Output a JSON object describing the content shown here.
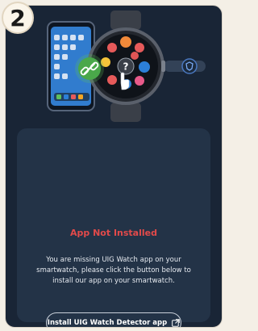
{
  "step": {
    "number": "2"
  },
  "illustration": {
    "phone_icon": "smartphone-icon",
    "watch_icon": "smartwatch-icon",
    "link_icon": "link-icon",
    "question_icon": "question-icon",
    "pointer_icon": "hand-pointer-icon",
    "accent_green": "#5fbf5b",
    "accent_blue": "#2c7fd8"
  },
  "card": {
    "title": "App Not Installed",
    "title_color": "#e24a4a",
    "description": "You are missing UIG Watch app on your smartwatch, please click the button below to install our app on your smartwatch.",
    "install_button_label": "Install UIG Watch Detector app",
    "install_button_icon": "external-link-icon"
  }
}
